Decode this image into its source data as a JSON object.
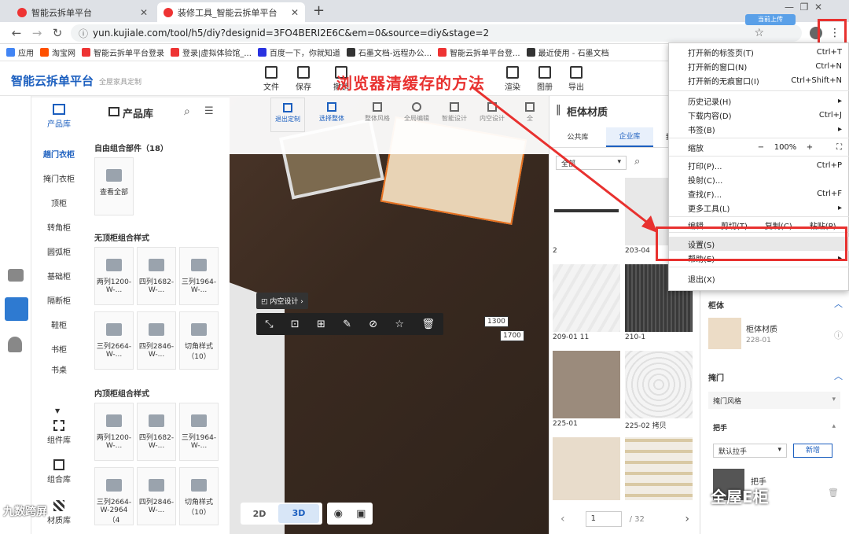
{
  "browser": {
    "tabs": [
      {
        "title": "智能云拆单平台"
      },
      {
        "title": "装修工具_智能云拆单平台"
      }
    ],
    "new_tab": "+",
    "url": "yun.kujiale.com/tool/h5/diy?designid=3FO4BERI2E6C&em=0&source=diy&stage=2",
    "bookmarks": [
      "应用",
      "淘宝网",
      "智能云拆单平台登录",
      "登录|虚拟体验馆_...",
      "百度一下，你就知道",
      "石墨文档-远程办公...",
      "智能云拆单平台登...",
      "最近使用 - 石墨文档"
    ],
    "upload_badge": "当前上传"
  },
  "chrome_menu": {
    "items": [
      {
        "label": "打开新的标签页(T)",
        "shortcut": "Ctrl+T"
      },
      {
        "label": "打开新的窗口(N)",
        "shortcut": "Ctrl+N"
      },
      {
        "label": "打开新的无痕窗口(I)",
        "shortcut": "Ctrl+Shift+N"
      },
      {
        "label": "历史记录(H)",
        "shortcut": "▸"
      },
      {
        "label": "下载内容(D)",
        "shortcut": "Ctrl+J"
      },
      {
        "label": "书签(B)",
        "shortcut": "▸"
      },
      {
        "label": "打印(P)...",
        "shortcut": "Ctrl+P"
      },
      {
        "label": "投射(C)...",
        "shortcut": ""
      },
      {
        "label": "查找(F)...",
        "shortcut": "Ctrl+F"
      },
      {
        "label": "更多工具(L)",
        "shortcut": "▸"
      },
      {
        "label": "设置(S)",
        "shortcut": ""
      },
      {
        "label": "帮助(E)",
        "shortcut": "▸"
      },
      {
        "label": "退出(X)",
        "shortcut": ""
      }
    ],
    "zoom_label": "缩放",
    "zoom_minus": "−",
    "zoom_value": "100%",
    "zoom_plus": "+",
    "edit_row": [
      "编辑",
      "剪切(T)",
      "复制(C)",
      "粘贴(P)"
    ]
  },
  "app": {
    "logo": "智能云拆单平台",
    "logo_sub": "全屋家具定制",
    "toolbar": [
      "文件",
      "保存",
      "撤销",
      "渲染",
      "图册",
      "导出"
    ],
    "overlay_title": "浏览器清缓存的方法",
    "sub_toolbar": [
      "退出定制",
      "选择整体",
      "整体风格",
      "全局编辑",
      "智能设计",
      "内空设计",
      "全"
    ]
  },
  "left_nav": {
    "items": [
      {
        "label": "产品库",
        "icon": "grid-icon"
      },
      {
        "label": "趟门衣柜"
      },
      {
        "label": "掩门衣柜"
      },
      {
        "label": "顶柜"
      },
      {
        "label": "转角柜"
      },
      {
        "label": "圆弧柜"
      },
      {
        "label": "基础柜"
      },
      {
        "label": "隔断柜"
      },
      {
        "label": "鞋柜"
      },
      {
        "label": "书柜"
      },
      {
        "label": "书桌"
      }
    ],
    "bottom": [
      {
        "label": "组件库"
      },
      {
        "label": "组合库"
      },
      {
        "label": "材质库"
      }
    ]
  },
  "library": {
    "title": "产品库",
    "section1": "自由组合部件（18）",
    "view_all": "查看全部",
    "section2": "无顶柜组合样式",
    "section3": "内顶柜组合样式",
    "row1": [
      "两列1200-W-...",
      "四列1682-W-...",
      "三列1964-W-..."
    ],
    "row2": [
      "三列2664-W-...",
      "四列2846-W-...",
      "切角样式（10）"
    ],
    "row3": [
      "两列1200-W-...",
      "四列1682-W-...",
      "三列1964-W-..."
    ],
    "row4": [
      "三列2664-W-2964（4",
      "四列2846-W-...",
      "切角样式（10）"
    ]
  },
  "canvas": {
    "dim1": "1300",
    "dim2": "1700",
    "popover": "内空设计",
    "view_2d": "2D",
    "view_3d": "3D"
  },
  "materials": {
    "title": "柜体材质",
    "tabs": [
      "公共库",
      "企业库",
      "我"
    ],
    "filter": "全部",
    "swatches": [
      {
        "label": "2",
        "color": "#ffffff"
      },
      {
        "label": "203-04",
        "color": "#e8e8e8"
      },
      {
        "label": "209-01 11",
        "color": "#f3f3f3"
      },
      {
        "label": "210-1",
        "color": "#3a3a3a"
      },
      {
        "label": "225-01",
        "color": "#9b8b7c"
      },
      {
        "label": "225-02 拷贝",
        "color": "#f4f4f4"
      },
      {
        "label": "",
        "color": "#e8dccb"
      },
      {
        "label": "",
        "color": "#f1ece3"
      }
    ],
    "page_current": "1",
    "page_total": "/ 32"
  },
  "props": {
    "section1": "柜体",
    "material_name": "柜体材质",
    "material_code": "228-01",
    "section2": "掩门",
    "door_style": "掩门风格",
    "handle": "把手",
    "handle_default": "默认拉手",
    "add_btn": "新增",
    "handle_item": "把手"
  },
  "watermarks": {
    "left": "九数跨屏",
    "right": "全屋E柜"
  },
  "colors": {
    "accent": "#1c5fbf",
    "annotation": "#e8312f"
  }
}
